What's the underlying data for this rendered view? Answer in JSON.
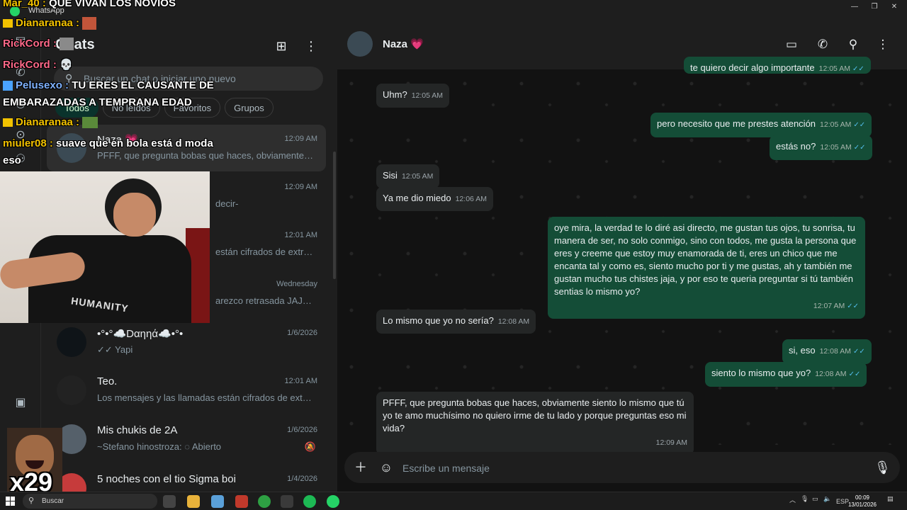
{
  "window": {
    "title": "WhatsApp"
  },
  "chatlist": {
    "title": "Chats",
    "search_placeholder": "Buscar un chat o iniciar uno nuevo",
    "filters": [
      "Todos",
      "No leídos",
      "Favoritos",
      "Grupos"
    ],
    "items": [
      {
        "name": "Naza 💗",
        "time": "12:09 AM",
        "preview": "PFFF, que pregunta bobas que haces, obviamente si..."
      },
      {
        "name": "",
        "time": "12:09 AM",
        "preview": "decir-"
      },
      {
        "name": "",
        "time": "12:01 AM",
        "preview": "están cifrados de extre..."
      },
      {
        "name": "",
        "time": "Wednesday",
        "preview": "arezco retrasada JAJAJA"
      },
      {
        "name": "•°•°☁️Dαηηά☁️•°•",
        "time": "1/6/2026",
        "preview": "✓✓ Yapi"
      },
      {
        "name": "Teo.",
        "time": "12:01 AM",
        "preview": "Los mensajes y las llamadas están cifrados de extre..."
      },
      {
        "name": "Mis chukis de 2A",
        "time": "1/6/2026",
        "preview": "~Stefano hinostroza: ◌ Abierto"
      },
      {
        "name": "5 noches con el tio Sigma boi",
        "time": "1/4/2026",
        "preview": ""
      }
    ]
  },
  "conversation": {
    "contact_name": "Naza 💗",
    "messages": [
      {
        "dir": "out",
        "text": "te quiero decir algo importante",
        "time": "12:05 AM"
      },
      {
        "dir": "in",
        "text": "Uhm?",
        "time": "12:05 AM"
      },
      {
        "dir": "out",
        "text": "pero necesito que me prestes atención",
        "time": "12:05 AM"
      },
      {
        "dir": "out",
        "text": "estás no?",
        "time": "12:05 AM"
      },
      {
        "dir": "in",
        "text": "Sisi",
        "time": "12:05 AM"
      },
      {
        "dir": "in",
        "text": "Ya me dio miedo",
        "time": "12:06 AM"
      },
      {
        "dir": "out",
        "text": "oye mira, la verdad te lo diré asi directo, me gustan tus ojos, tu sonrisa, tu manera de ser, no solo conmigo, sino con todos, me gusta la persona que eres y creeme que estoy muy enamorada de ti, eres un chico que me encanta tal y como es, siento mucho por ti y me gustas, ah y también me gustan mucho tus chistes jaja, y por eso te queria preguntar si tú también sentias lo mismo yo?",
        "time": "12:07 AM"
      },
      {
        "dir": "in",
        "text": "Lo mismo que yo no sería?",
        "time": "12:08 AM"
      },
      {
        "dir": "out",
        "text": "si, eso",
        "time": "12:08 AM"
      },
      {
        "dir": "out",
        "text": "siento lo mismo que yo?",
        "time": "12:08 AM"
      },
      {
        "dir": "in",
        "text": "PFFF, que pregunta bobas que haces, obviamente siento lo mismo que tú yo te amo muchísimo no quiero irme de tu lado y porque preguntas eso mi vida?",
        "time": "12:09 AM"
      }
    ],
    "composer_placeholder": "Escribe un mensaje"
  },
  "stream_chat": [
    {
      "user": "Mar_40",
      "text": "QUE VIVAN LOS NOVIOS",
      "color": "#f2c200"
    },
    {
      "user": "Dianaranaa",
      "text": "",
      "color": "#f2c200"
    },
    {
      "user": "RickCord",
      "text": "",
      "color": "#ff6a8a"
    },
    {
      "user": "RickCord",
      "text": "💀",
      "color": "#ff6a8a"
    },
    {
      "user": "Pelusexo",
      "text": "TU ERES EL CAUSANTE DE",
      "color": "#7fb2ff"
    },
    {
      "user": "",
      "text": "EMBARAZADAS A TEMPRANA EDAD",
      "color": "#ffffff"
    },
    {
      "user": "Dianaranaa",
      "text": "",
      "color": "#f2c200"
    },
    {
      "user": "miuler08",
      "text": "suave que en bola está d moda",
      "color": "#f2c200"
    },
    {
      "user": "",
      "text": "eso",
      "color": "#ffffff"
    }
  ],
  "webcam": {
    "shirt_text": "HUMANITY"
  },
  "sticker": {
    "multiplier": "x29"
  },
  "taskbar": {
    "search_label": "Buscar",
    "language": "ESP",
    "time": "00:09",
    "date": "13/01/2026"
  },
  "colors": {
    "accent": "#25d366",
    "outgoing_bubble": "#144d37",
    "incoming_bubble": "#242626"
  }
}
